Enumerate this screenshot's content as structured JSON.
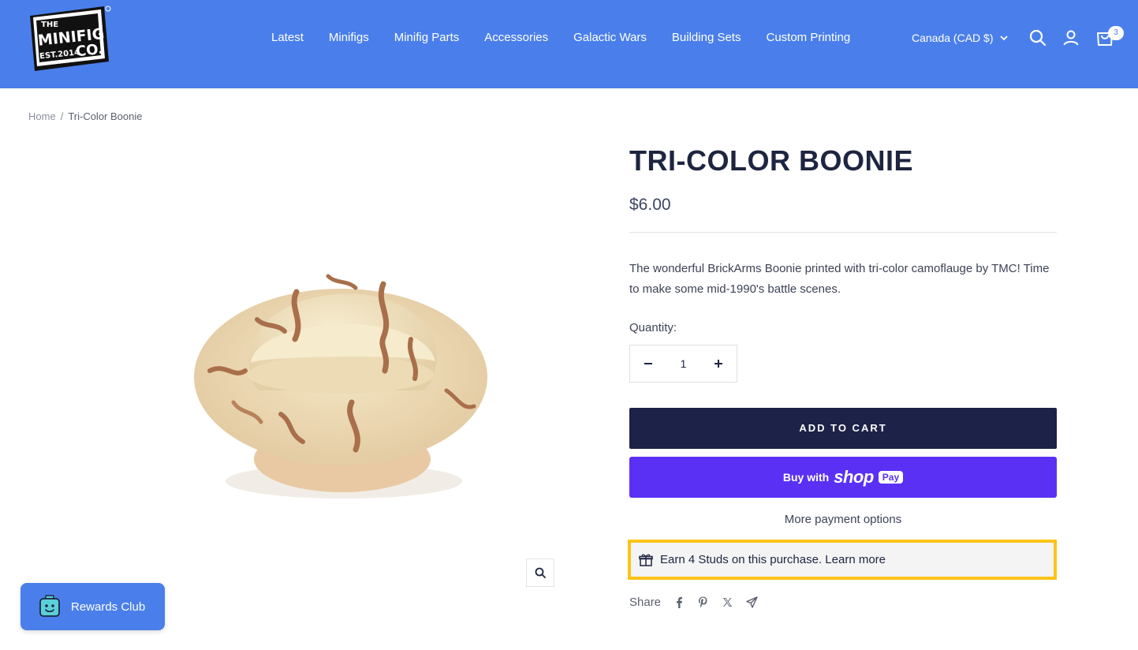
{
  "header": {
    "logo_text": {
      "line1": "THE",
      "line2": "MINIFIG",
      "line3": "EST.2014",
      "line4": "CO."
    },
    "nav": [
      "Latest",
      "Minifigs",
      "Minifig Parts",
      "Accessories",
      "Galactic Wars",
      "Building Sets",
      "Custom Printing"
    ],
    "currency": "Canada (CAD $)",
    "cart_count": "3",
    "icons": {
      "search": "search-icon",
      "account": "user-icon",
      "cart": "cart-icon"
    }
  },
  "breadcrumb": {
    "home": "Home",
    "separator": "/",
    "current": "Tri-Color Boonie"
  },
  "product": {
    "title": "TRI-COLOR BOONIE",
    "price": "$6.00",
    "description": "The wonderful BrickArms Boonie printed with tri-color camoflauge by TMC! Time to make some mid-1990's battle scenes.",
    "quantity_label": "Quantity:",
    "quantity_value": "1",
    "add_to_cart": "ADD TO CART",
    "buy_with": "Buy with",
    "shop_pay_brand": "shop",
    "shop_pay_badge": "Pay",
    "more_payment": "More payment options",
    "studs_text": "Earn 4 Studs on this purchase.",
    "studs_link": "Learn more",
    "share_label": "Share"
  },
  "rewards": {
    "label": "Rewards Club"
  },
  "colors": {
    "header_bg": "#4a7feb",
    "primary_button": "#1c2248",
    "shop_pay": "#5a31f4",
    "highlight": "#fcc419"
  }
}
